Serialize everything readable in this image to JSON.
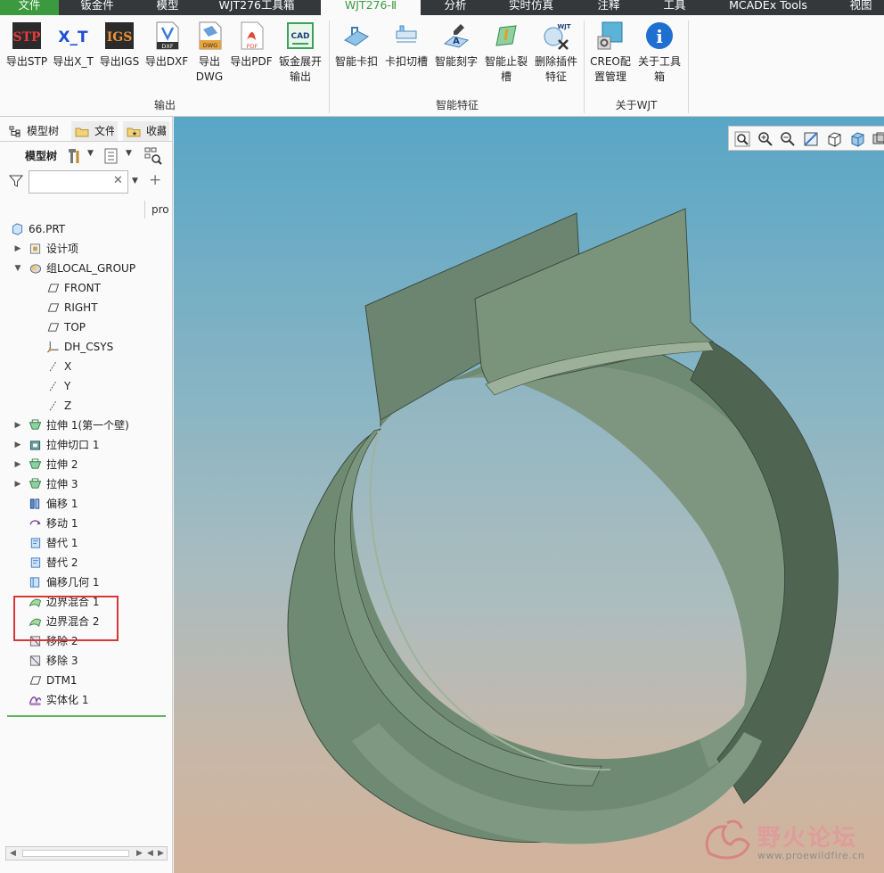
{
  "tabs": [
    "文件",
    "钣金件",
    "模型",
    "WJT276工具箱",
    "WJT276-Ⅱ",
    "分析",
    "实时仿真",
    "注释",
    "工具",
    "MCADEx Tools",
    "视图"
  ],
  "ribbon": {
    "groups": {
      "export": {
        "label": "输出",
        "buttons": [
          {
            "label": "导出STP",
            "icon": "stp-icon"
          },
          {
            "label": "导出X_T",
            "icon": "xt-icon"
          },
          {
            "label": "导出IGS",
            "icon": "igs-icon"
          },
          {
            "label": "导出DXF",
            "icon": "dxf-icon"
          },
          {
            "label": "导出\nDWG",
            "icon": "dwg-icon"
          },
          {
            "label": "导出PDF",
            "icon": "pdf-icon"
          },
          {
            "label": "钣金展开\n输出",
            "icon": "cad-unfold-icon"
          }
        ]
      },
      "smart": {
        "label": "智能特征",
        "buttons": [
          {
            "label": "智能卡扣",
            "icon": "snap-icon"
          },
          {
            "label": "卡扣切槽",
            "icon": "snap-slot-icon"
          },
          {
            "label": "智能刻字",
            "icon": "engrave-icon"
          },
          {
            "label": "智能止裂\n槽",
            "icon": "relief-icon"
          },
          {
            "label": "删除插件\n特征",
            "icon": "delete-feature-icon"
          }
        ]
      },
      "about": {
        "label": "关于WJT",
        "buttons": [
          {
            "label": "CREO配\n置管理",
            "icon": "config-icon"
          },
          {
            "label": "关于工具\n箱",
            "icon": "info-icon"
          }
        ]
      }
    }
  },
  "panel": {
    "tabs": [
      "模型树",
      "文件",
      "收藏"
    ],
    "toolbar_label": "模型树",
    "search_value": "",
    "column_header": "pro"
  },
  "tree": [
    {
      "label": "66.PRT",
      "icon": "part-icon",
      "expander": ""
    },
    {
      "label": "设计项",
      "icon": "design-items-icon",
      "expander": "▶"
    },
    {
      "label": "组LOCAL_GROUP",
      "icon": "group-icon",
      "expander": "▼"
    },
    {
      "label": "FRONT",
      "icon": "datum-plane-icon",
      "expander": ""
    },
    {
      "label": "RIGHT",
      "icon": "datum-plane-icon",
      "expander": ""
    },
    {
      "label": "TOP",
      "icon": "datum-plane-icon",
      "expander": ""
    },
    {
      "label": "DH_CSYS",
      "icon": "csys-icon",
      "expander": ""
    },
    {
      "label": "X",
      "icon": "axis-icon",
      "expander": ""
    },
    {
      "label": "Y",
      "icon": "axis-icon",
      "expander": ""
    },
    {
      "label": "Z",
      "icon": "axis-icon",
      "expander": ""
    },
    {
      "label": "拉伸 1(第一个壁)",
      "icon": "extrude-wall-icon",
      "expander": "▶"
    },
    {
      "label": "拉伸切口 1",
      "icon": "extrude-cut-icon",
      "expander": "▶"
    },
    {
      "label": "拉伸 2",
      "icon": "extrude-wall-icon",
      "expander": "▶"
    },
    {
      "label": "拉伸 3",
      "icon": "extrude-wall-icon",
      "expander": "▶"
    },
    {
      "label": "偏移 1",
      "icon": "offset-icon",
      "expander": ""
    },
    {
      "label": "移动 1",
      "icon": "move-icon",
      "expander": ""
    },
    {
      "label": "替代 1",
      "icon": "replace-icon",
      "expander": ""
    },
    {
      "label": "替代 2",
      "icon": "replace-icon",
      "expander": ""
    },
    {
      "label": "偏移几何 1",
      "icon": "offset-geometry-icon",
      "expander": ""
    },
    {
      "label": "边界混合 1",
      "icon": "boundary-blend-icon",
      "expander": ""
    },
    {
      "label": "边界混合 2",
      "icon": "boundary-blend-icon",
      "expander": ""
    },
    {
      "label": "移除 2",
      "icon": "remove-icon",
      "expander": ""
    },
    {
      "label": "移除 3",
      "icon": "remove-icon",
      "expander": ""
    },
    {
      "label": "DTM1",
      "icon": "datum-plane-icon",
      "expander": ""
    },
    {
      "label": "实体化 1",
      "icon": "solidify-icon",
      "expander": ""
    }
  ],
  "watermark": {
    "title": "野火论坛",
    "url": "www.proewildfire.cn"
  },
  "colors": {
    "accent": "#3b9a3e",
    "tabbar": "#34383b",
    "highlight": "#d9363a",
    "model": "#6f8a72"
  }
}
